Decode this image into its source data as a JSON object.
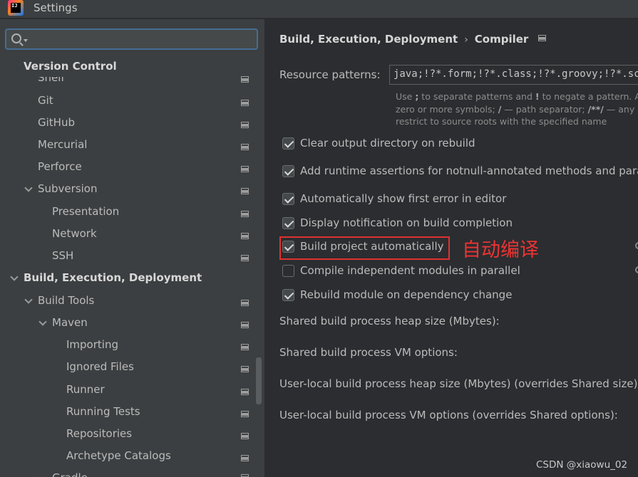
{
  "window": {
    "title": "Settings",
    "app_icon_text": "IJ"
  },
  "search": {
    "placeholder": "",
    "value": ""
  },
  "tree": [
    {
      "label": "Version Control",
      "level": 0,
      "bold": true
    },
    {
      "label": "Shelf",
      "level": 1
    },
    {
      "label": "Git",
      "level": 1
    },
    {
      "label": "GitHub",
      "level": 1
    },
    {
      "label": "Mercurial",
      "level": 1
    },
    {
      "label": "Perforce",
      "level": 1
    },
    {
      "label": "Subversion",
      "level": 1,
      "expanded": true
    },
    {
      "label": "Presentation",
      "level": 2
    },
    {
      "label": "Network",
      "level": 2
    },
    {
      "label": "SSH",
      "level": 2
    },
    {
      "label": "Build, Execution, Deployment",
      "level": 0,
      "bold": true,
      "expanded": true
    },
    {
      "label": "Build Tools",
      "level": 1,
      "expanded": true
    },
    {
      "label": "Maven",
      "level": 2,
      "expanded": true
    },
    {
      "label": "Importing",
      "level": 3
    },
    {
      "label": "Ignored Files",
      "level": 3
    },
    {
      "label": "Runner",
      "level": 3
    },
    {
      "label": "Running Tests",
      "level": 3
    },
    {
      "label": "Repositories",
      "level": 3
    },
    {
      "label": "Archetype Catalogs",
      "level": 3
    },
    {
      "label": "Gradle",
      "level": 2
    }
  ],
  "breadcrumb": {
    "parent": "Build, Execution, Deployment",
    "separator": "›",
    "current": "Compiler"
  },
  "resource_patterns": {
    "label": "Resource patterns:",
    "value": "java;!?*.form;!?*.class;!?*.groovy;!?*.scala;!?*.flex;!?*.kt;!?*.clj",
    "hint_line1_a": "Use ",
    "hint_line1_b": ";",
    "hint_line1_c": " to separate patterns and ",
    "hint_line1_d": "!",
    "hint_line1_e": " to negate a pattern. Ac",
    "hint_line2_a": "zero or more symbols; ",
    "hint_line2_b": "/",
    "hint_line2_c": " — path separator; ",
    "hint_line2_d": "/**/",
    "hint_line2_e": " — any n",
    "hint_line3": "restrict to source roots with the specified name"
  },
  "options": [
    {
      "label": "Clear output directory on rebuild",
      "checked": true
    },
    {
      "label": "Add runtime assertions for notnull-annotated methods and parameters",
      "checked": true
    },
    {
      "label": "Automatically show first error in editor",
      "checked": true
    },
    {
      "label": "Display notification on build completion",
      "checked": true
    },
    {
      "label": "Build project automatically",
      "checked": true
    },
    {
      "label": "Compile independent modules in parallel",
      "checked": false
    },
    {
      "label": "Rebuild module on dependency change",
      "checked": true
    }
  ],
  "fields": [
    {
      "label": "Shared build process heap size (Mbytes):"
    },
    {
      "label": "Shared build process VM options:"
    },
    {
      "label": "User-local build process heap size (Mbytes) (overrides Shared size):"
    },
    {
      "label": "User-local build process VM options (overrides Shared options):"
    }
  ],
  "annotation": {
    "text": "自动编译",
    "color": "#ee3333"
  },
  "watermark": "CSDN @xiaowu_02",
  "colors": {
    "accent": "#466d94",
    "highlight_box": "#e03131"
  }
}
